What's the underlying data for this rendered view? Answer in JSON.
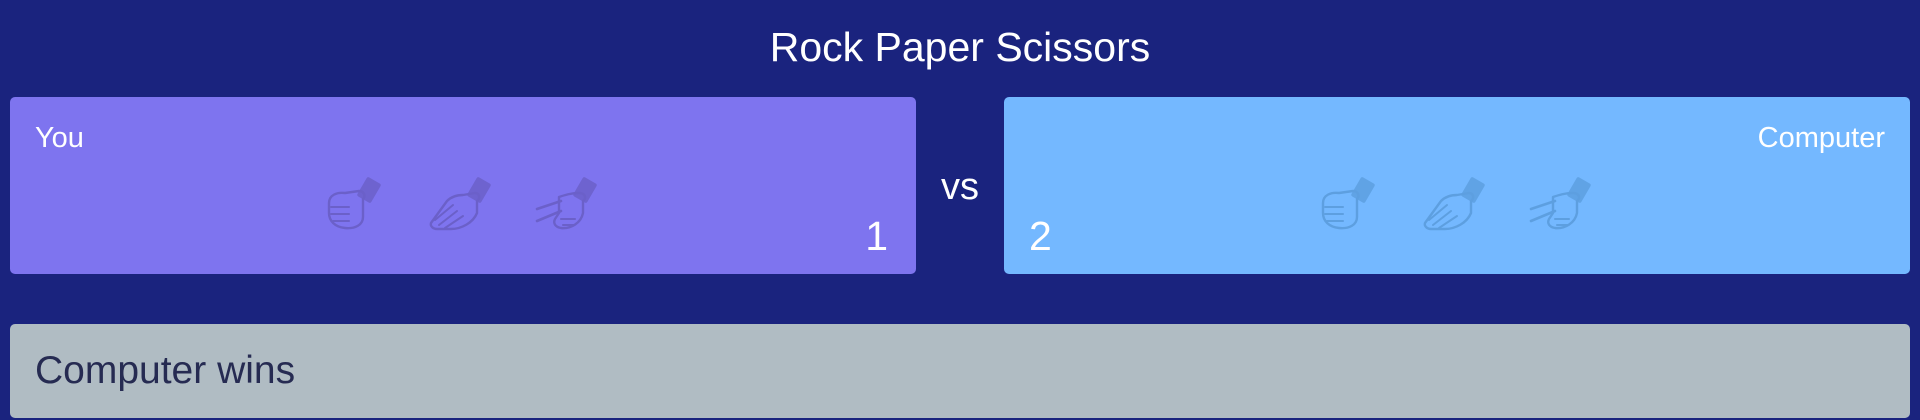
{
  "game": {
    "title": "Rock Paper Scissors",
    "vs_label": "vs",
    "result_text": "Computer wins"
  },
  "player": {
    "label": "You",
    "score": "1",
    "panel_color": "#7e74ef"
  },
  "computer": {
    "label": "Computer",
    "score": "2",
    "panel_color": "#74b8ff"
  },
  "choices": [
    {
      "name": "rock",
      "icon": "rock-hand-icon"
    },
    {
      "name": "paper",
      "icon": "paper-hand-icon"
    },
    {
      "name": "scissors",
      "icon": "scissors-hand-icon"
    }
  ],
  "colors": {
    "background": "#1a237e",
    "result_bar": "#b0bcc3",
    "result_text": "#262b52"
  }
}
